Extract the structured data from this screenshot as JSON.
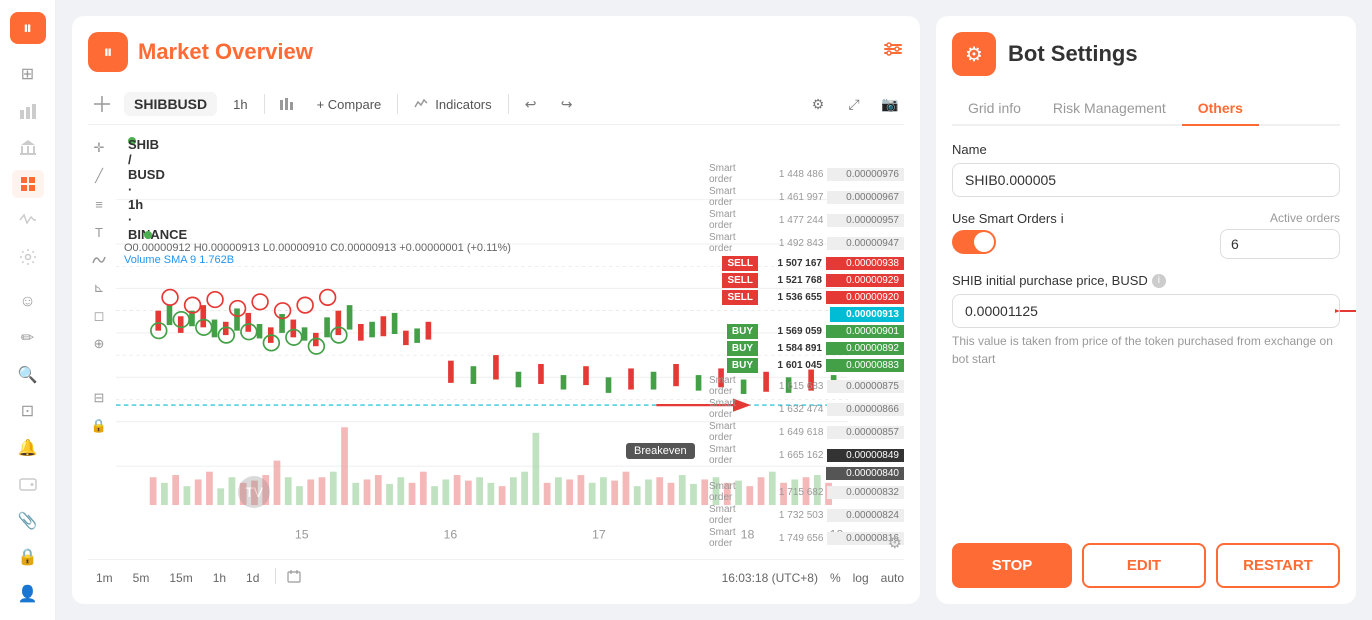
{
  "sidebar": {
    "logo": "⏸",
    "items": [
      {
        "name": "dashboard",
        "icon": "⊞",
        "active": false
      },
      {
        "name": "chart",
        "icon": "📊",
        "active": false
      },
      {
        "name": "bank",
        "icon": "🏦",
        "active": false
      },
      {
        "name": "grid",
        "icon": "⊡",
        "active": true
      },
      {
        "name": "activity",
        "icon": "📈",
        "active": false
      },
      {
        "name": "filter",
        "icon": "⚙",
        "active": false
      },
      {
        "name": "smiley",
        "icon": "☺",
        "active": false
      },
      {
        "name": "pencil",
        "icon": "✏",
        "active": false
      },
      {
        "name": "zoom-in",
        "icon": "+🔍",
        "active": false
      },
      {
        "name": "home",
        "icon": "🏠",
        "active": false
      },
      {
        "name": "bell",
        "icon": "🔔",
        "active": false
      },
      {
        "name": "wallet",
        "icon": "💰",
        "active": false
      },
      {
        "name": "clip",
        "icon": "📎",
        "active": false
      },
      {
        "name": "lock",
        "icon": "🔒",
        "active": false
      },
      {
        "name": "user",
        "icon": "👤",
        "active": false
      }
    ]
  },
  "market_overview": {
    "title": "Market Overview",
    "icon": "⏸",
    "chart": {
      "symbol": "SHIBBUSD",
      "timeframe": "1h",
      "pair": "SHIB / BUSD · 1h · BINANCE",
      "ohlc": "O0.00000912  H0.00000913  L0.00000910  C0.00000913  +0.00000001 (+0.11%)",
      "volume": "Volume SMA 9",
      "volume_value": "1.762B",
      "toolbar": {
        "compare": "+ Compare",
        "indicators": "Indicators"
      },
      "sell_orders": [
        {
          "label": "SELL",
          "value": "1 507 167",
          "price": "0.00000938"
        },
        {
          "label": "SELL",
          "value": "1 521 768",
          "price": "0.00000929"
        },
        {
          "label": "SELL",
          "value": "1 536 655",
          "price": "0.00000920"
        }
      ],
      "current_price": "0.00000913",
      "buy_orders": [
        {
          "label": "BUY",
          "value": "1 569 059",
          "price": "0.00000901"
        },
        {
          "label": "BUY",
          "value": "1 584 891",
          "price": "0.00000892"
        },
        {
          "label": "BUY",
          "value": "1 601 045",
          "price": "0.00000883"
        }
      ],
      "smart_orders": [
        {
          "label": "Smart order",
          "value": "1 448 486",
          "price": "0.00000976"
        },
        {
          "label": "Smart order",
          "value": "1 461 997",
          "price": "0.00000967"
        },
        {
          "label": "Smart order",
          "value": "1 477 244",
          "price": "0.00000957"
        },
        {
          "label": "Smart order",
          "value": "1 492 843",
          "price": "0.00000947"
        },
        {
          "label": "Smart order",
          "value": "1 615 683",
          "price": "0.00000875"
        },
        {
          "label": "Smart order",
          "value": "1 632 474",
          "price": "0.00000866"
        },
        {
          "label": "Smart order",
          "value": "1 649 618",
          "price": "0.00000857"
        },
        {
          "label": "Smart order",
          "value": "1 665 162",
          "price": "0.00000849"
        },
        {
          "label": "Smart order",
          "value": "1 715 682",
          "price": "0.00000832"
        },
        {
          "label": "Smart order",
          "value": "1 732 503",
          "price": "0.00000824"
        },
        {
          "label": "Smart order",
          "value": "1 749 656",
          "price": "0.00000816"
        }
      ],
      "breakeven": "Breakeven",
      "dates": [
        "15",
        "16",
        "17",
        "18",
        "19"
      ],
      "timestamp": "16:03:18 (UTC+8)"
    },
    "timeframes": [
      "1m",
      "5m",
      "15m",
      "1h",
      "1d"
    ],
    "chart_bottom_right": {
      "percent": "%",
      "log": "log",
      "auto": "auto"
    }
  },
  "bot_settings": {
    "title": "Bot Settings",
    "icon": "⚙",
    "tabs": [
      {
        "label": "Grid info",
        "active": false
      },
      {
        "label": "Risk Management",
        "active": false
      },
      {
        "label": "Others",
        "active": true
      }
    ],
    "fields": {
      "name_label": "Name",
      "name_value": "SHIB0.000005",
      "use_smart_orders_label": "Use Smart Orders",
      "use_smart_orders_info": "ℹ",
      "toggle_state": true,
      "active_orders_label": "Active orders",
      "active_orders_value": "6",
      "shib_price_label": "SHIB initial purchase price, BUSD",
      "shib_price_info": "ℹ",
      "shib_price_value": "0.00001125",
      "shib_price_info_text": "This value is taken from price of the token purchased from exchange on bot start"
    },
    "buttons": {
      "stop": "STOP",
      "edit": "EDIT",
      "restart": "RESTART"
    }
  }
}
